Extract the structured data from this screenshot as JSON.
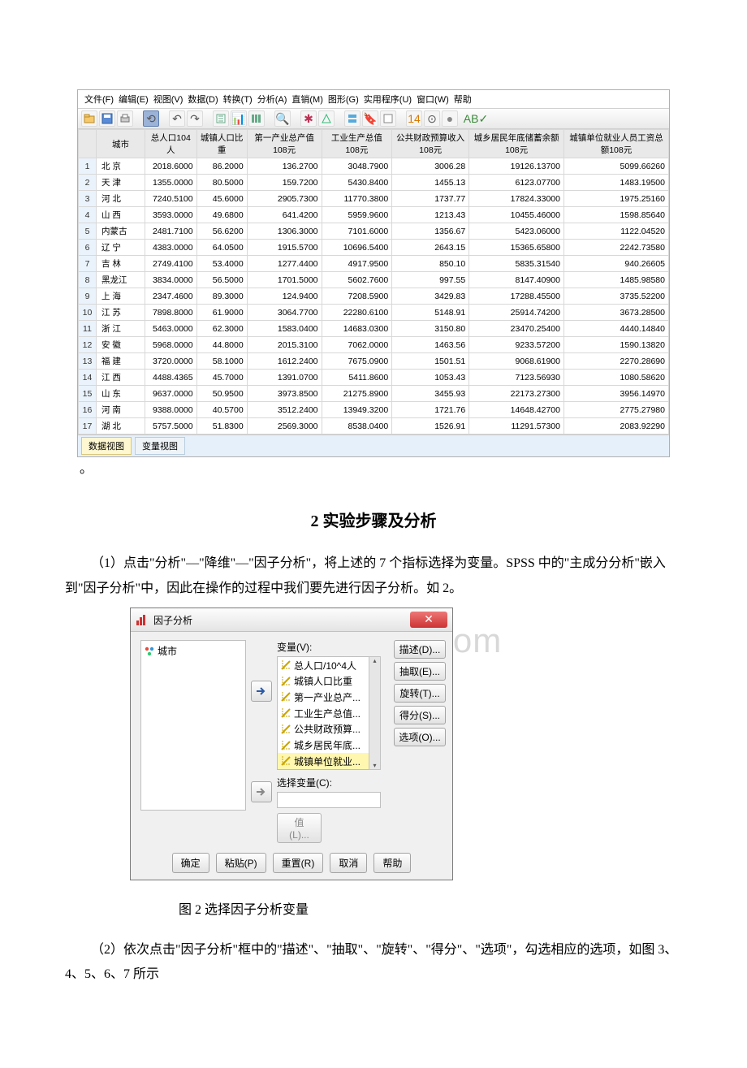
{
  "spss": {
    "menu": [
      "文件(F)",
      "编辑(E)",
      "视图(V)",
      "数据(D)",
      "转换(T)",
      "分析(A)",
      "直销(M)",
      "图形(G)",
      "实用程序(U)",
      "窗口(W)",
      "帮助"
    ],
    "columns": [
      "",
      "城市",
      "总人口104人",
      "城镇人口比重",
      "第一产业总产值108元",
      "工业生产总值108元",
      "公共财政预算收入108元",
      "城乡居民年底储蓄余额108元",
      "城镇单位就业人员工资总额108元"
    ],
    "rows": [
      {
        "n": "1",
        "city": "北 京",
        "v": [
          "2018.6000",
          "86.2000",
          "136.2700",
          "3048.7900",
          "3006.28",
          "19126.13700",
          "5099.66260"
        ]
      },
      {
        "n": "2",
        "city": "天 津",
        "v": [
          "1355.0000",
          "80.5000",
          "159.7200",
          "5430.8400",
          "1455.13",
          "6123.07700",
          "1483.19500"
        ]
      },
      {
        "n": "3",
        "city": "河 北",
        "v": [
          "7240.5100",
          "45.6000",
          "2905.7300",
          "11770.3800",
          "1737.77",
          "17824.33000",
          "1975.25160"
        ]
      },
      {
        "n": "4",
        "city": "山 西",
        "v": [
          "3593.0000",
          "49.6800",
          "641.4200",
          "5959.9600",
          "1213.43",
          "10455.46000",
          "1598.85640"
        ]
      },
      {
        "n": "5",
        "city": "内蒙古",
        "v": [
          "2481.7100",
          "56.6200",
          "1306.3000",
          "7101.6000",
          "1356.67",
          "5423.06000",
          "1122.04520"
        ]
      },
      {
        "n": "6",
        "city": "辽 宁",
        "v": [
          "4383.0000",
          "64.0500",
          "1915.5700",
          "10696.5400",
          "2643.15",
          "15365.65800",
          "2242.73580"
        ]
      },
      {
        "n": "7",
        "city": "吉 林",
        "v": [
          "2749.4100",
          "53.4000",
          "1277.4400",
          "4917.9500",
          "850.10",
          "5835.31540",
          "940.26605"
        ]
      },
      {
        "n": "8",
        "city": "黑龙江",
        "v": [
          "3834.0000",
          "56.5000",
          "1701.5000",
          "5602.7600",
          "997.55",
          "8147.40900",
          "1485.98580"
        ]
      },
      {
        "n": "9",
        "city": "上 海",
        "v": [
          "2347.4600",
          "89.3000",
          "124.9400",
          "7208.5900",
          "3429.83",
          "17288.45500",
          "3735.52200"
        ]
      },
      {
        "n": "10",
        "city": "江 苏",
        "v": [
          "7898.8000",
          "61.9000",
          "3064.7700",
          "22280.6100",
          "5148.91",
          "25914.74200",
          "3673.28500"
        ]
      },
      {
        "n": "11",
        "city": "浙 江",
        "v": [
          "5463.0000",
          "62.3000",
          "1583.0400",
          "14683.0300",
          "3150.80",
          "23470.25400",
          "4440.14840"
        ]
      },
      {
        "n": "12",
        "city": "安 徽",
        "v": [
          "5968.0000",
          "44.8000",
          "2015.3100",
          "7062.0000",
          "1463.56",
          "9233.57200",
          "1590.13820"
        ]
      },
      {
        "n": "13",
        "city": "福 建",
        "v": [
          "3720.0000",
          "58.1000",
          "1612.2400",
          "7675.0900",
          "1501.51",
          "9068.61900",
          "2270.28690"
        ]
      },
      {
        "n": "14",
        "city": "江 西",
        "v": [
          "4488.4365",
          "45.7000",
          "1391.0700",
          "5411.8600",
          "1053.43",
          "7123.56930",
          "1080.58620"
        ]
      },
      {
        "n": "15",
        "city": "山 东",
        "v": [
          "9637.0000",
          "50.9500",
          "3973.8500",
          "21275.8900",
          "3455.93",
          "22173.27300",
          "3956.14970"
        ]
      },
      {
        "n": "16",
        "city": "河 南",
        "v": [
          "9388.0000",
          "40.5700",
          "3512.2400",
          "13949.3200",
          "1721.76",
          "14648.42700",
          "2775.27980"
        ]
      },
      {
        "n": "17",
        "city": "湖 北",
        "v": [
          "5757.5000",
          "51.8300",
          "2569.3000",
          "8538.0400",
          "1526.91",
          "11291.57300",
          "2083.92290"
        ]
      }
    ],
    "tabs": {
      "data": "数据视图",
      "var": "变量视图"
    }
  },
  "punct_dot": "。",
  "section_title": "2 实验步骤及分析",
  "para1": "（1）点击\"分析\"—\"降维\"—\"因子分析\"，将上述的 7 个指标选择为变量。SPSS 中的\"主成分分析\"嵌入到\"因子分析\"中，因此在操作的过程中我们要先进行因子分析。如 2。",
  "watermark": "www.bdocx.com",
  "dialog": {
    "title": "因子分析",
    "left_item": "城市",
    "var_label": "变量(V):",
    "vars": [
      "总人口/10^4人",
      "城镇人口比重",
      "第一产业总产...",
      "工业生产总值...",
      "公共财政预算...",
      "城乡居民年底...",
      "城镇单位就业..."
    ],
    "select_label": "选择变量(C):",
    "value_btn": "值(L)...",
    "right_btns": [
      "描述(D)...",
      "抽取(E)...",
      "旋转(T)...",
      "得分(S)...",
      "选项(O)..."
    ],
    "bottom_btns": [
      "确定",
      "粘贴(P)",
      "重置(R)",
      "取消",
      "帮助"
    ]
  },
  "caption": "图 2 选择因子分析变量",
  "para2": "（2）依次点击\"因子分析\"框中的\"描述\"、\"抽取\"、\"旋转\"、\"得分\"、\"选项\"，勾选相应的选项，如图 3、4、5、6、7 所示"
}
